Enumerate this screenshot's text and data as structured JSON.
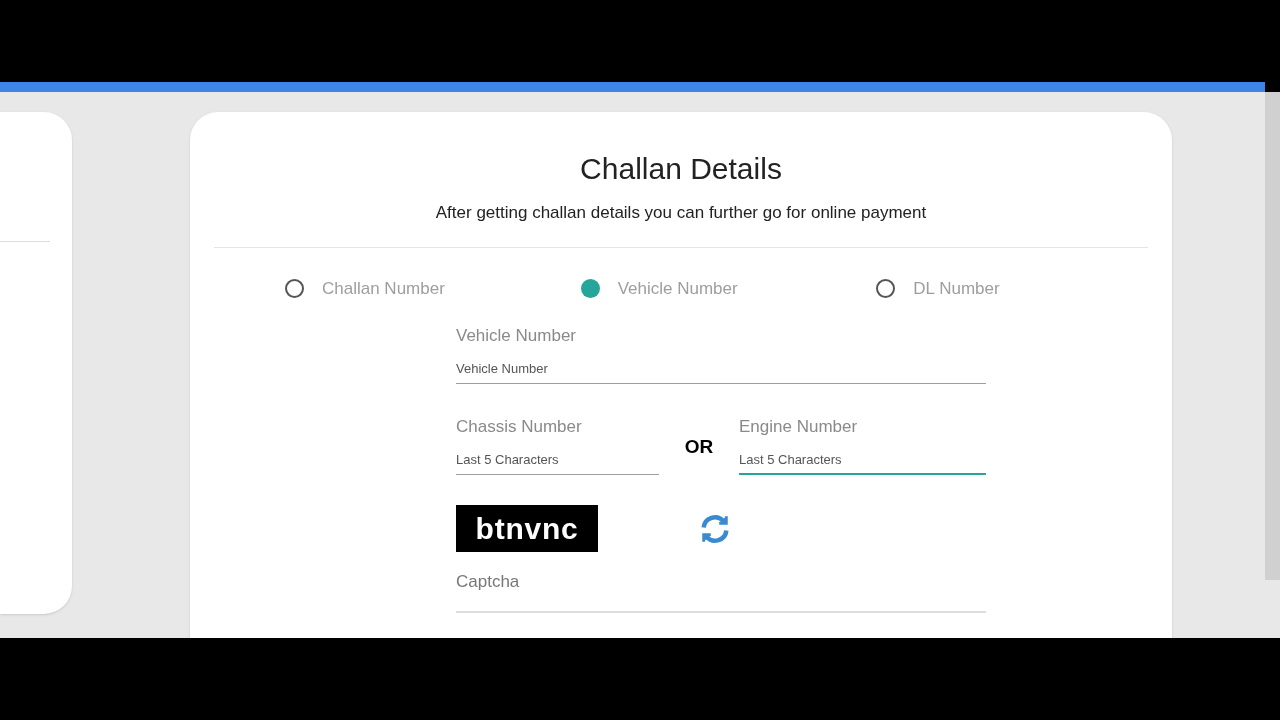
{
  "card": {
    "title": "Challan Details",
    "subtitle": "After getting challan details you can further go for online payment"
  },
  "search_by": [
    {
      "label": "Challan Number",
      "selected": false
    },
    {
      "label": "Vehicle Number",
      "selected": true
    },
    {
      "label": "DL Number",
      "selected": false
    }
  ],
  "vehicle_field": {
    "label": "Vehicle Number",
    "placeholder": "Vehicle Number",
    "focused": false
  },
  "chassis_field": {
    "label": "Chassis Number",
    "placeholder": "Last 5 Characters",
    "focused": false
  },
  "separator": "OR",
  "engine_field": {
    "label": "Engine Number",
    "placeholder": "Last 5 Characters",
    "focused": true
  },
  "captcha": {
    "code": "btnvnc",
    "field": {
      "label": "Captcha",
      "focused": false
    }
  }
}
